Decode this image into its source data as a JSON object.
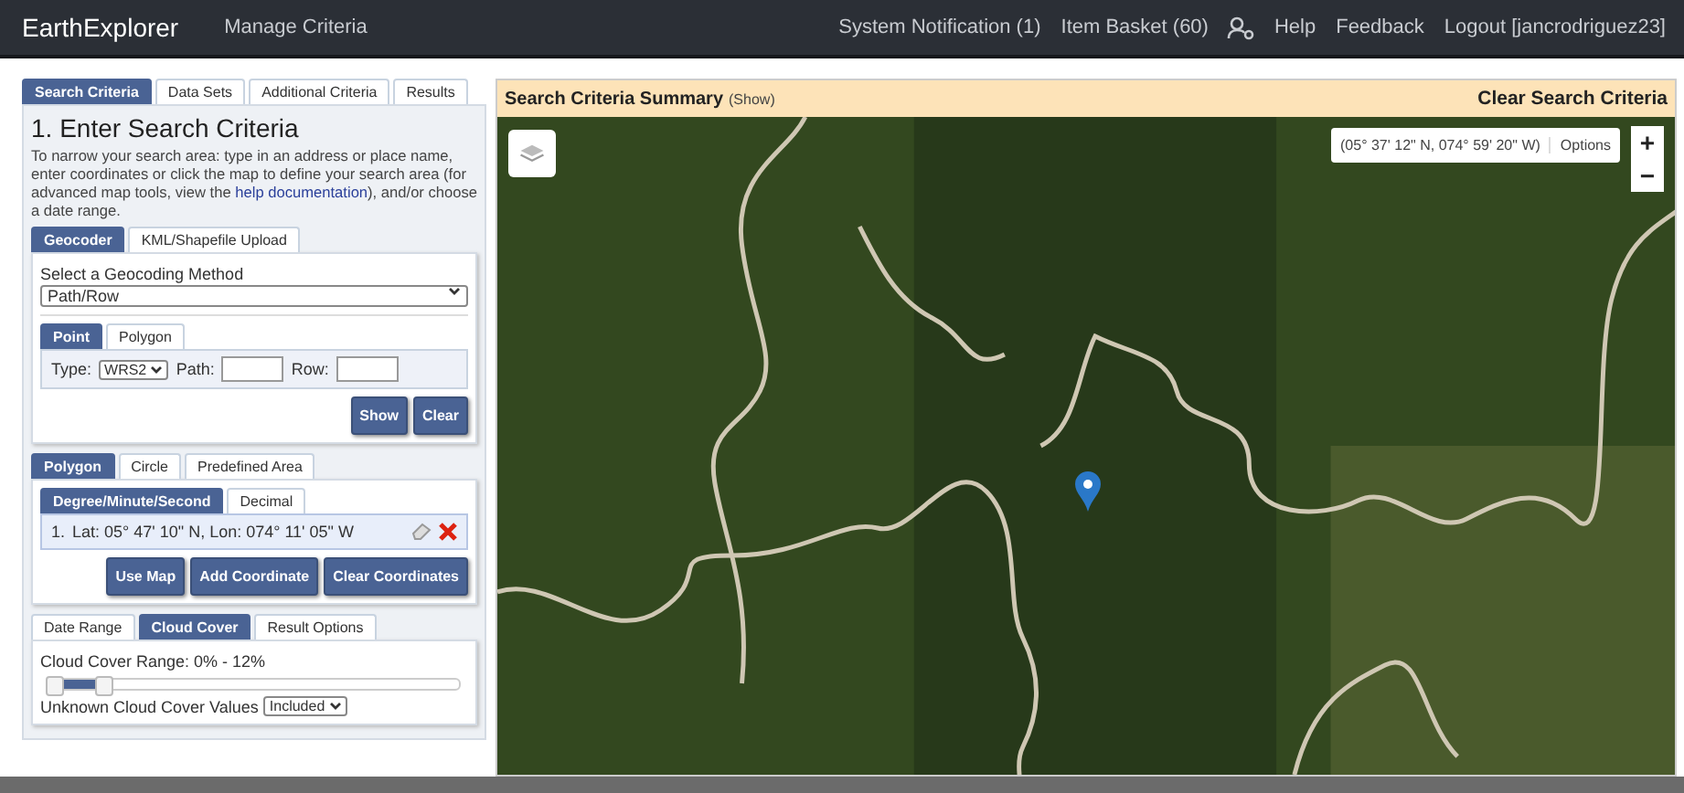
{
  "navbar": {
    "brand": "EarthExplorer",
    "links": [
      {
        "label": "Manage Criteria",
        "kind": "text"
      },
      {
        "label": "System Notification (1)",
        "kind": "text"
      },
      {
        "label": "Item Basket (60)",
        "kind": "text"
      },
      {
        "kind": "user-icon"
      },
      {
        "label": "Help",
        "kind": "text"
      },
      {
        "label": "Feedback",
        "kind": "text"
      },
      {
        "label": "Logout [jancrodriguez23]",
        "kind": "text"
      }
    ]
  },
  "main_tabs": [
    {
      "label": "Search Criteria",
      "selected": true
    },
    {
      "label": "Data Sets",
      "selected": false
    },
    {
      "label": "Additional Criteria",
      "selected": false
    },
    {
      "label": "Results",
      "selected": false
    }
  ],
  "heading": "1. Enter Search Criteria",
  "intro": "To narrow your search area: type in an address or place name, enter coordinates or click the map to define your search area (for advanced map tools, view the ",
  "intro_link": "help documentation",
  "intro_end": "), and/or choose a date range.",
  "geo_tabs": [
    {
      "label": "Geocoder",
      "selected": true
    },
    {
      "label": "KML/Shapefile Upload",
      "selected": false
    }
  ],
  "geocoding": {
    "label": "Select a Geocoding Method",
    "value": "Path/Row"
  },
  "point_tabs": [
    {
      "label": "Point",
      "selected": true
    },
    {
      "label": "Polygon",
      "selected": false
    }
  ],
  "path_row": {
    "type_label": "Type:",
    "type_value": "WRS2",
    "path_label": "Path:",
    "row_label": "Row:"
  },
  "geo_buttons": [
    "Show",
    "Clear"
  ],
  "area_tabs": [
    {
      "label": "Polygon",
      "selected": true
    },
    {
      "label": "Circle",
      "selected": false
    },
    {
      "label": "Predefined Area",
      "selected": false
    }
  ],
  "format_tabs": [
    {
      "label": "Degree/Minute/Second",
      "selected": true
    },
    {
      "label": "Decimal",
      "selected": false
    }
  ],
  "coordinates": [
    {
      "index": "1.",
      "text": "Lat: 05° 47' 10\" N, Lon: 074° 11' 05\" W"
    }
  ],
  "coord_buttons": [
    "Use Map",
    "Add Coordinate",
    "Clear Coordinates"
  ],
  "bottom_tabs": [
    {
      "label": "Date Range",
      "selected": false
    },
    {
      "label": "Cloud Cover",
      "selected": true
    },
    {
      "label": "Result Options",
      "selected": false
    }
  ],
  "cloud": {
    "range_label": "Cloud Cover Range: 0% - 12%",
    "level": 0.12,
    "unknown_label": "Unknown Cloud Cover Values",
    "unknown_value": "Included"
  },
  "summary": {
    "title": "Search Criteria Summary",
    "toggle": "(Show)",
    "clear": "Clear Search Criteria"
  },
  "map": {
    "coordinates": "(05° 37' 12\" N, 074° 59' 20\" W)",
    "options": "Options",
    "zoom_in": "+",
    "zoom_out": "−"
  }
}
